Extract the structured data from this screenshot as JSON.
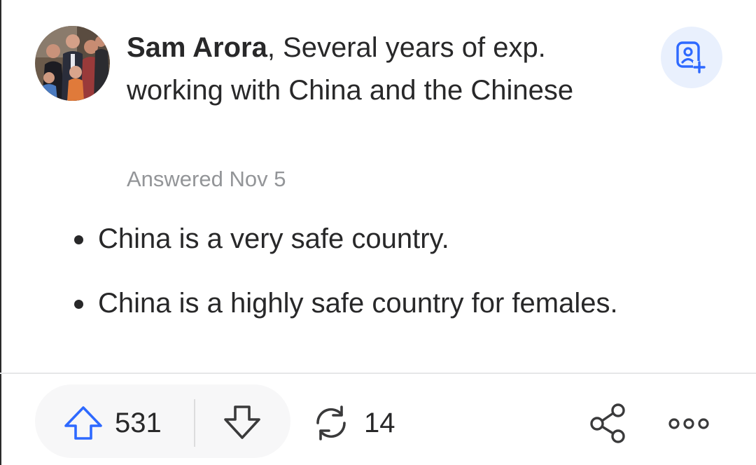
{
  "author": {
    "name": "Sam Arora",
    "credential": ", Several years of exp. working with China and the Chinese",
    "avatar_icon": "family-photo-avatar"
  },
  "answer_meta": {
    "date": "Answered Nov 5"
  },
  "answer": {
    "bullets": [
      "China is a very safe country.",
      "China is a highly safe country for females."
    ]
  },
  "actions": {
    "upvote_count": "531",
    "share_count": "14",
    "icons": {
      "follow": "add-user-icon",
      "upvote": "upvote-arrow-icon",
      "downvote": "downvote-arrow-icon",
      "share": "reshare-icon",
      "share_link": "share-icon",
      "more": "more-options-icon"
    }
  },
  "colors": {
    "accent": "#2e69ff",
    "text": "#282829",
    "muted": "#939598",
    "follow_bg": "#e9f0fd",
    "pill_bg": "#f7f7f8"
  }
}
